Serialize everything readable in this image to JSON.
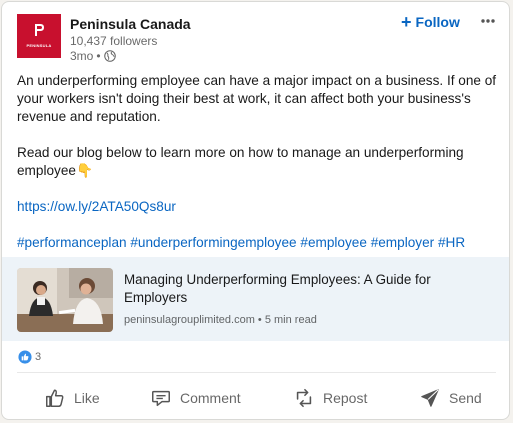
{
  "author": {
    "name": "Peninsula Canada",
    "followers": "10,437 followers",
    "time": "3mo",
    "separator": "•",
    "logo_text": "PENINSULA",
    "brand_color": "#c8102e"
  },
  "header": {
    "follow_label": "Follow",
    "follow_icon": "plus-icon",
    "more_icon": "more-horizontal-icon"
  },
  "post": {
    "paragraph1": "An underperforming employee can have a major impact on a business. If one of your workers isn't doing their best at work, it can affect both your business's revenue and reputation.",
    "paragraph2": "Read our blog below to learn more on how to manage an underperforming employee",
    "emoji": "👇",
    "link": "https://ow.ly/2ATA50Qs8ur",
    "hashtags": [
      "#performanceplan",
      "#underperformingemployee",
      "#employee",
      "#employer",
      "#HR"
    ]
  },
  "article": {
    "title": "Managing Underperforming Employees: A Guide for Employers",
    "source": "peninsulagrouplimited.com",
    "separator": "•",
    "read_time": "5 min read"
  },
  "reactions": {
    "icon": "like-reaction-icon",
    "count": "3"
  },
  "actions": [
    {
      "label": "Like",
      "icon": "thumbs-up-icon"
    },
    {
      "label": "Comment",
      "icon": "comment-icon"
    },
    {
      "label": "Repost",
      "icon": "repost-icon"
    },
    {
      "label": "Send",
      "icon": "send-icon"
    }
  ],
  "colors": {
    "link": "#0a66c2",
    "article_bg": "#edf3f8"
  }
}
